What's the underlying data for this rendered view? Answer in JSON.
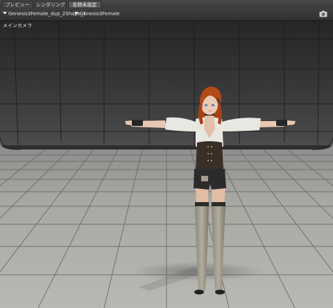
{
  "tabs": [
    {
      "label": "プレビュー"
    },
    {
      "label": "レンダリング"
    },
    {
      "label": "名称未設定"
    }
  ],
  "toolbar": {
    "node_select": "Genesis3Female_dup_2Shape_1",
    "figure_select": "Genesis3Female",
    "camera_icon": "camera-icon"
  },
  "viewport": {
    "camera_label": "メインカメラ"
  }
}
